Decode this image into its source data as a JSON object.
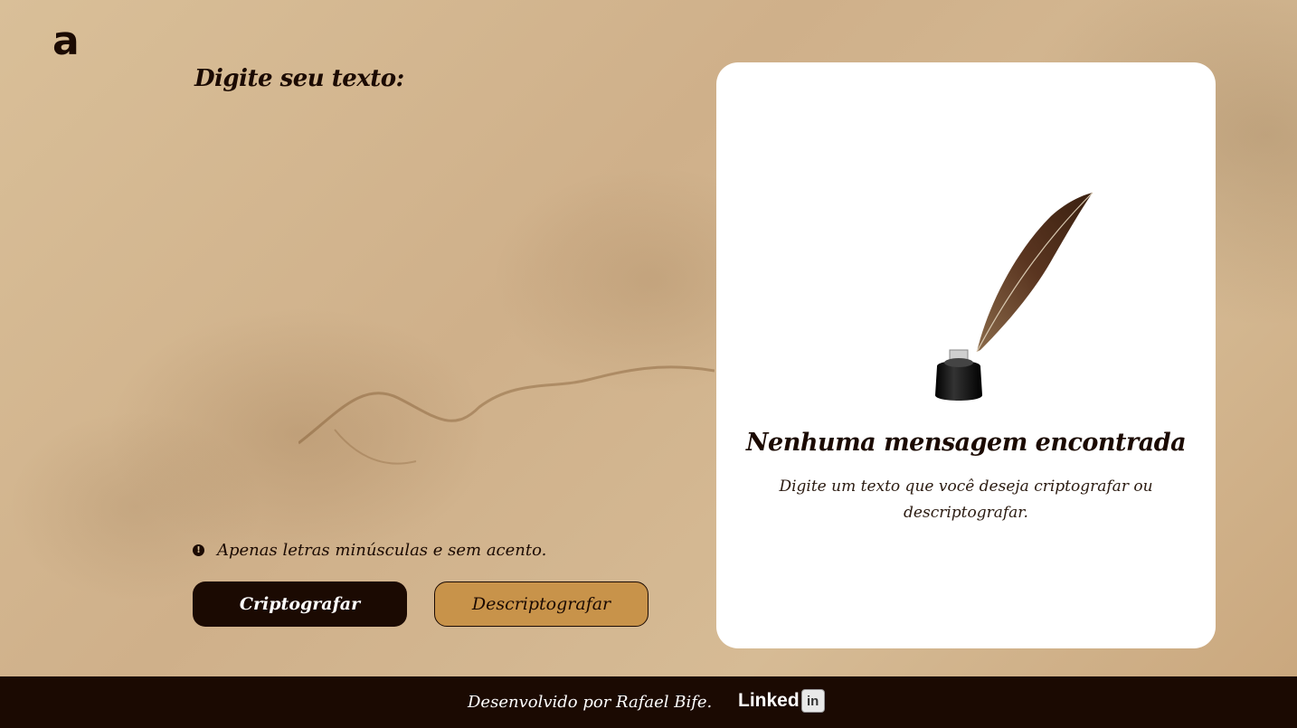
{
  "logo": {
    "glyph": "a"
  },
  "input": {
    "title": "Digite seu texto:",
    "value": ""
  },
  "hint": {
    "icon": "info-circle-icon",
    "icon_glyph": "!",
    "text": "Apenas letras minúsculas e sem acento."
  },
  "buttons": {
    "encrypt_label": "Criptografar",
    "decrypt_label": "Descriptografar"
  },
  "output": {
    "image": "quill-inkwell-illustration",
    "title": "Nenhuma mensagem encontrada",
    "text": "Digite um texto que você deseja criptografar ou descriptografar."
  },
  "footer": {
    "credit": "Desenvolvido por Rafael Bife.",
    "linkedin_word": "Linked",
    "linkedin_badge": "in"
  },
  "colors": {
    "dark_brown": "#1b0a02",
    "gold": "#c8934a",
    "parchment": "#d9bf98",
    "card": "#ffffff"
  }
}
